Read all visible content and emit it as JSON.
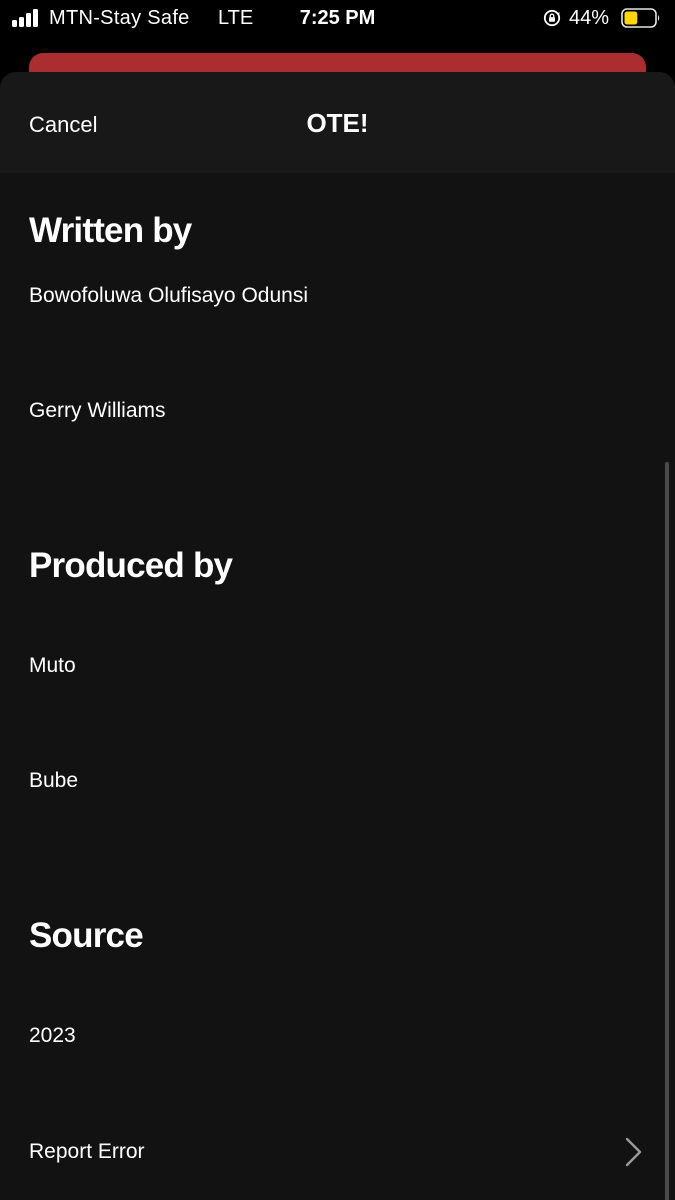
{
  "status_bar": {
    "carrier": "MTN-Stay Safe",
    "network": "LTE",
    "time": "7:25 PM",
    "battery_percent": "44%",
    "battery_level": 0.44,
    "battery_color": "#ffd60a"
  },
  "colors": {
    "sheet_background": "#121212",
    "header_background": "#181818",
    "behind_card": "#ab2d2f"
  },
  "header": {
    "cancel_label": "Cancel",
    "title": "OTE!"
  },
  "sections": {
    "written_by": {
      "title": "Written by",
      "names": [
        "Bowofoluwa Olufisayo Odunsi",
        "Gerry Williams"
      ]
    },
    "produced_by": {
      "title": "Produced by",
      "names": [
        "Muto",
        "Bube"
      ]
    },
    "source": {
      "title": "Source",
      "value": "2023"
    }
  },
  "report": {
    "label": "Report Error",
    "icon": "chevron-right-icon"
  }
}
